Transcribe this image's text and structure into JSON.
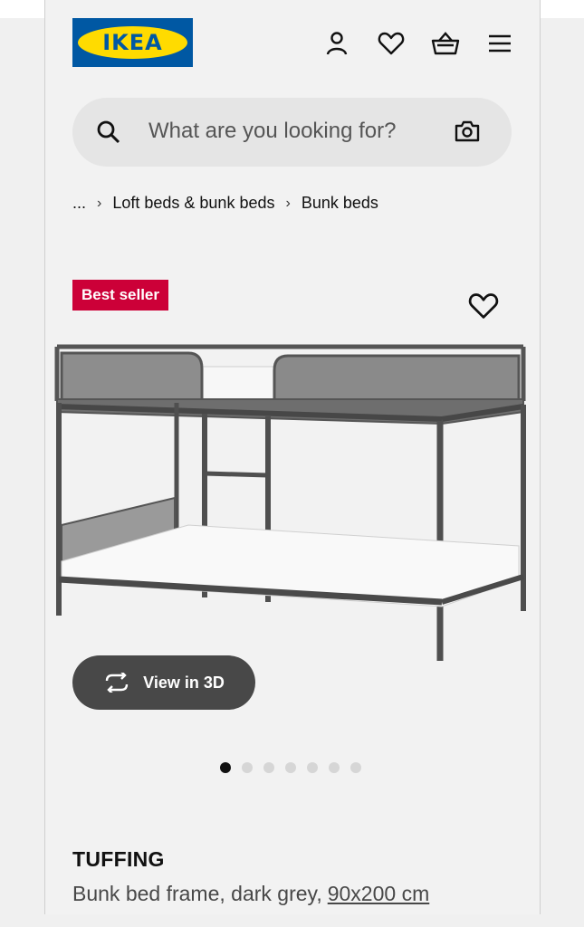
{
  "brand": {
    "logo_text": "IKEA",
    "primary_color": "#0058a3",
    "secondary_color": "#ffdb00"
  },
  "header": {
    "icons": [
      "account-icon",
      "favourites-icon",
      "shopping-basket-icon",
      "menu-icon"
    ]
  },
  "search": {
    "placeholder": "What are you looking for?"
  },
  "breadcrumb": {
    "items": [
      "...",
      "Loft beds & bunk beds",
      "Bunk beds"
    ]
  },
  "product": {
    "badge": "Best seller",
    "badge_color": "#cc0038",
    "view_3d_label": "View in 3D",
    "image_count": 7,
    "active_image": 1,
    "name": "TUFFING",
    "description": "Bunk bed frame, dark grey,",
    "dimensions": "90x200 cm"
  }
}
